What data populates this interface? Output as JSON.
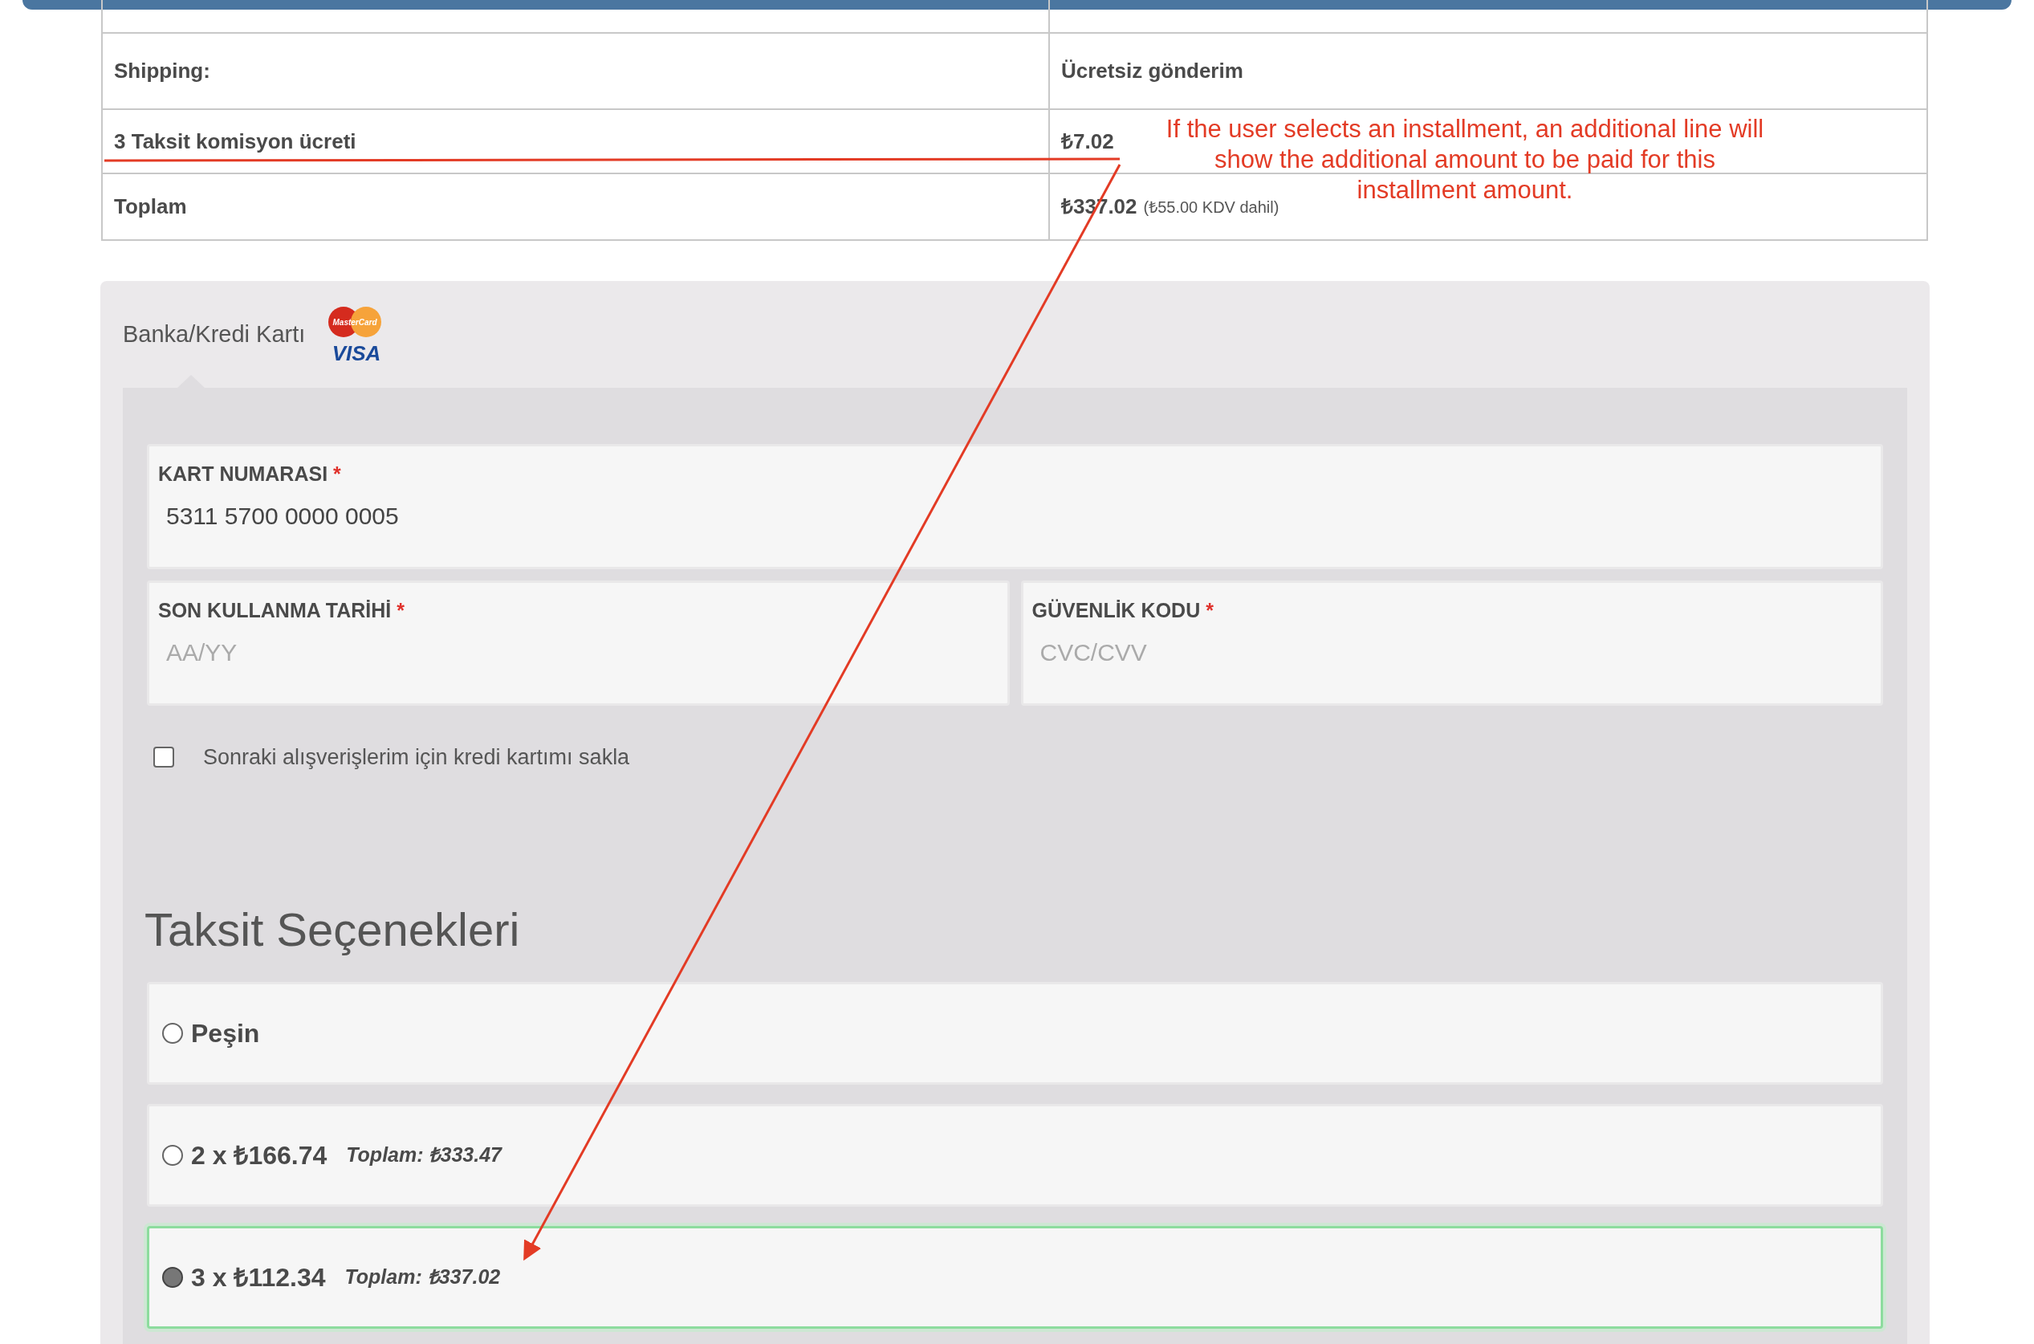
{
  "summary_table": {
    "rows": [
      {
        "label": "Shipping:",
        "value": "Ücretsiz gönderim"
      },
      {
        "label": "3 Taksit komisyon ücreti",
        "value": "₺7.02"
      },
      {
        "label": "Toplam",
        "value": "₺337.02",
        "note": "(₺55.00 KDV dahil)"
      }
    ]
  },
  "annotation": {
    "text": "If the user selects an installment, an additional line will show the additional amount to be paid for this installment amount."
  },
  "payment": {
    "tab_label": "Banka/Kredi Kartı",
    "logo_texts": [
      "MasterCard",
      "VISA"
    ],
    "fields": [
      {
        "label": "KART NUMARASI",
        "required_mark": "*",
        "value": "5311 5700 0000 0005"
      },
      {
        "label": "SON KULLANMA TARİHİ",
        "required_mark": "*",
        "placeholder": "AA/YY"
      },
      {
        "label": "GÜVENLİK KODU",
        "required_mark": "*",
        "placeholder": "CVC/CVV"
      }
    ],
    "save_card": {
      "label": "Sonraki alışverişlerim için kredi kartımı sakla",
      "checked": false
    }
  },
  "installments": {
    "title": "Taksit Seçenekleri",
    "options": [
      {
        "label": "Peşin",
        "selected": false
      },
      {
        "label": "2 x ₺166.74",
        "total": "Toplam: ₺333.47",
        "selected": false
      },
      {
        "label": "3 x ₺112.34",
        "total": "Toplam: ₺337.02",
        "selected": true
      }
    ]
  }
}
